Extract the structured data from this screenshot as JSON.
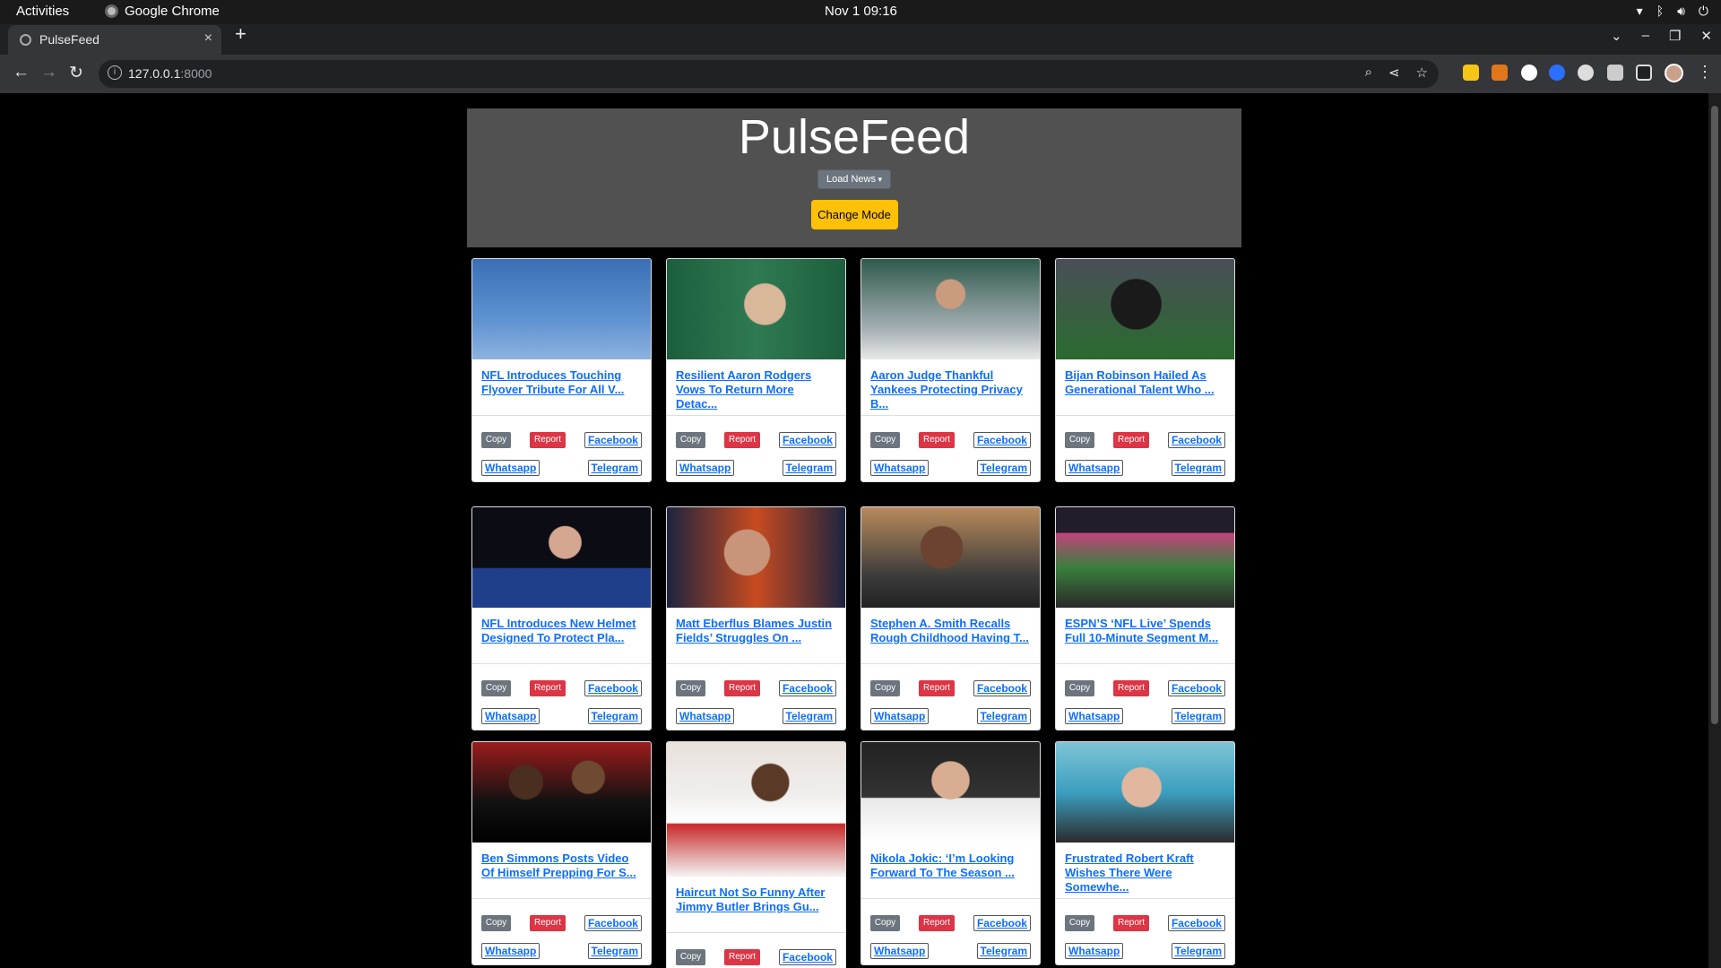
{
  "os_bar": {
    "activities": "Activities",
    "app_name": "Google Chrome",
    "clock": "Nov 1  09:16"
  },
  "browser": {
    "tab_title": "PulseFeed",
    "url_host": "127.0.0.1",
    "url_port": ":8000"
  },
  "page": {
    "title": "PulseFeed",
    "load_news_label": "Load News",
    "change_mode_label": "Change Mode"
  },
  "buttons": {
    "copy": "Copy",
    "report": "Report",
    "facebook": "Facebook",
    "whatsapp": "Whatsapp",
    "telegram": "Telegram"
  },
  "articles": [
    {
      "headline": "NFL Introduces Touching Flyover Tribute For All V...",
      "image": "fighter-jets-flyover"
    },
    {
      "headline": "Resilient Aaron Rodgers Vows To Return More Detac...",
      "image": "aaron-rodgers-jets-presser"
    },
    {
      "headline": "Aaron Judge Thankful Yankees Protecting Privacy B...",
      "image": "aaron-judge-yankees"
    },
    {
      "headline": "Bijan Robinson Hailed As Generational Talent Who ...",
      "image": "bijan-robinson-running"
    },
    {
      "headline": "NFL Introduces New Helmet Designed To Protect Pla...",
      "image": "roger-goodell-podium"
    },
    {
      "headline": "Matt Eberflus Blames Justin Fields’ Struggles On ...",
      "image": "matt-eberflus-presser"
    },
    {
      "headline": "Stephen A. Smith Recalls Rough Childhood Having T...",
      "image": "stephen-a-smith-court"
    },
    {
      "headline": "ESPN’S ‘NFL Live’ Spends Full 10-Minute Segment M...",
      "image": "nfl-live-studio"
    },
    {
      "headline": "Ben Simmons Posts Video Of Himself Prepping For S...",
      "image": "ben-simmons-nets"
    },
    {
      "headline": "Haircut Not So Funny After Jimmy Butler Brings Gu...",
      "image": "jimmy-butler-heat"
    },
    {
      "headline": "Nikola Jokic: ‘I’m Looking Forward To The Season ...",
      "image": "nikola-jokic-nuggets"
    },
    {
      "headline": "Frustrated Robert Kraft Wishes There Were Somewhe...",
      "image": "robert-kraft-cap"
    }
  ]
}
